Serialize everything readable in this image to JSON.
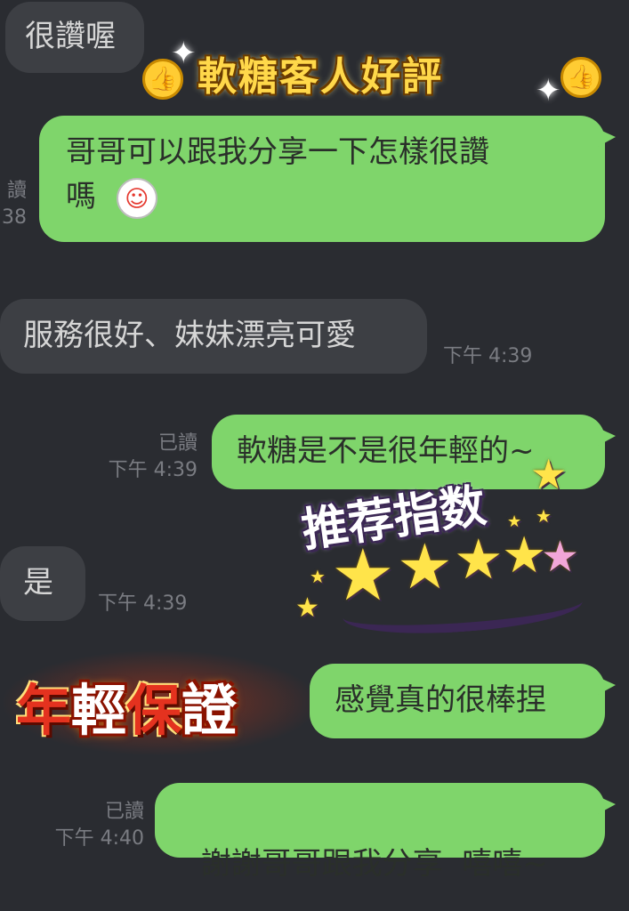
{
  "messages": [
    {
      "side": "left",
      "text": "很讚喔"
    },
    {
      "side": "right",
      "text_line1": "哥哥可以跟我分享一下怎樣很讚",
      "text_line2": "嗎",
      "read": "讀",
      "time": "38"
    },
    {
      "side": "left",
      "text": "服務很好、妹妹漂亮可愛",
      "time": "下午 4:39"
    },
    {
      "side": "right",
      "text": "軟糖是不是很年輕的~",
      "read": "已讀",
      "time": "下午 4:39"
    },
    {
      "side": "left",
      "text": "是",
      "time": "下午 4:39"
    },
    {
      "side": "right",
      "text": "感覺真的很棒捏"
    },
    {
      "side": "right",
      "text": "謝謝哥哥跟我分享  嘻嘻~",
      "read": "已讀",
      "time": "下午 4:40"
    }
  ],
  "overlays": {
    "title": "軟糖客人好評",
    "recommend": "推荐指数",
    "recommend_stars": 5,
    "youth": [
      "年",
      "輕",
      "保",
      "證"
    ]
  },
  "icons": {
    "thumb": "thumbs-up-icon",
    "sparkle": "sparkle-icon",
    "sticker": "laughing-face-icon",
    "star": "star-icon"
  },
  "colors": {
    "background": "#2a2c31",
    "bubble_left": "#3d3f44",
    "bubble_right": "#7fd56b"
  }
}
